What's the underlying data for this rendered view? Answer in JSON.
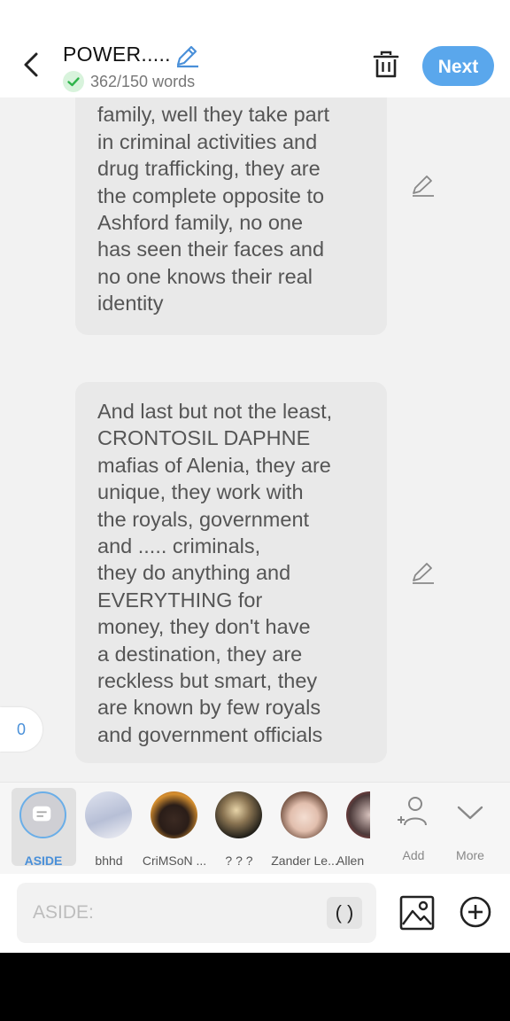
{
  "header": {
    "title": "POWER.....",
    "word_count": "362/150 words",
    "next_label": "Next"
  },
  "messages": [
    {
      "text": "are next to the ASHFORD\nfamily, well they take part\nin criminal activities and\ndrug trafficking, they are\nthe complete opposite to\nAshford family, no one\nhas seen their faces and\nno one knows their real\nidentity"
    },
    {
      "text": "And last but not the least,\nCRONTOSIL DAPHNE\nmafias of Alenia, they are\nunique, they work with\nthe royals, government\nand ..... criminals,\nthey do anything and\nEVERYTHING for\nmoney, they don't have\na destination, they are\nreckless but smart, they\nare known by few royals\nand government officials"
    }
  ],
  "side_counter": "0",
  "characters": [
    {
      "name": "ASIDE"
    },
    {
      "name": "bhhd"
    },
    {
      "name": "CriMSoN ..."
    },
    {
      "name": "? ? ?"
    },
    {
      "name": "Zander Le..."
    },
    {
      "name": "Allen"
    }
  ],
  "char_actions": {
    "add": "Add",
    "more": "More"
  },
  "composer": {
    "placeholder": "ASIDE:",
    "paren": "( )"
  },
  "colors": {
    "accent": "#5aa7ec",
    "bubble": "#e9e9e9",
    "check_green": "#2fb44b"
  }
}
